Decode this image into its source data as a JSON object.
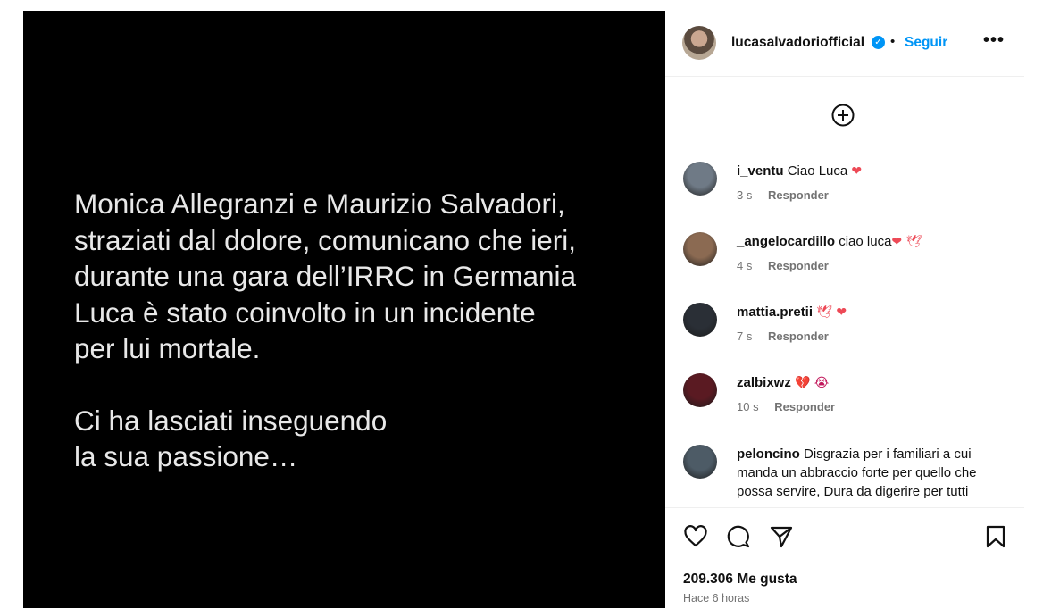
{
  "media": {
    "paragraph1": [
      "Monica Allegranzi e Maurizio Salvadori,",
      "straziati dal dolore, comunicano che ieri,",
      "durante una gara dell’IRRC in Germania",
      "Luca è stato coinvolto in un incidente",
      "per lui mortale."
    ],
    "paragraph2": [
      "Ci ha lasciati inseguendo",
      "la sua passione…"
    ]
  },
  "header": {
    "username": "lucasalvadoriofficial",
    "separator": "•",
    "follow_label": "Seguir",
    "more_label": "•••"
  },
  "comments": [
    {
      "user": "i_ventu",
      "text": "Ciao Luca ",
      "emoji": "❤",
      "time": "3 s",
      "reply": "Responder",
      "avatar_color": "#6f7a86"
    },
    {
      "user": "_angelocardillo",
      "text": "ciao luca",
      "emoji": "❤ 🕊",
      "time": "4 s",
      "reply": "Responder",
      "avatar_color": "#8b6a52"
    },
    {
      "user": "mattia.pretii",
      "text": "",
      "emoji": "🕊 ❤",
      "time": "7 s",
      "reply": "Responder",
      "avatar_color": "#2a2f36"
    },
    {
      "user": "zalbixwz",
      "text": "",
      "emoji": "💔 😭",
      "time": "10 s",
      "reply": "Responder",
      "avatar_color": "#5a1a22"
    },
    {
      "user": "peloncino",
      "text": "Disgrazia per i familiari a cui manda un abbraccio forte per quello che possa servire, Dura da digerire per tutti",
      "emoji": "",
      "time": "",
      "reply": "",
      "avatar_color": "#4d5b66"
    }
  ],
  "footer": {
    "likes": "209.306 Me gusta",
    "posted_ago": "Hace 6 horas"
  },
  "colors": {
    "accent": "#0095f6",
    "heart": "#ed4956",
    "muted": "#737373"
  },
  "icons": {
    "header": [
      "verified-badge-icon",
      "more-options-icon"
    ],
    "top": "add-circle-icon",
    "actions": [
      "heart-icon",
      "comment-icon",
      "share-icon",
      "bookmark-icon"
    ]
  }
}
